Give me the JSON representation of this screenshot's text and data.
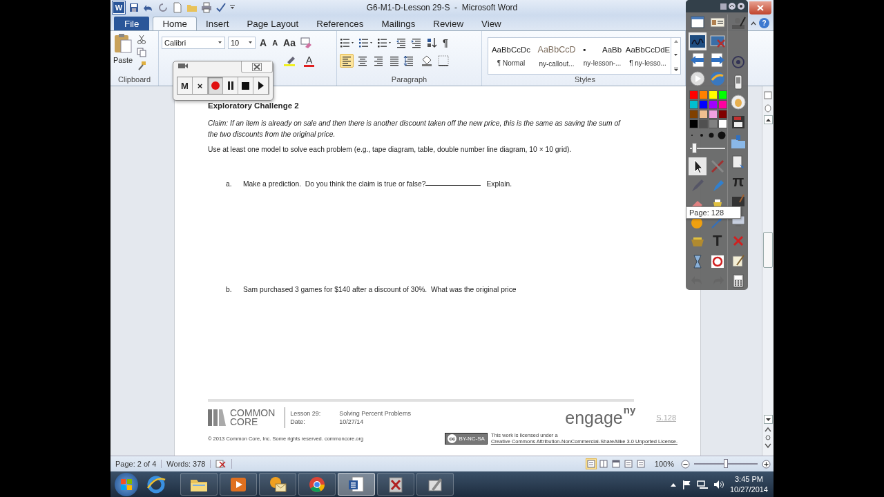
{
  "window": {
    "app_icon": "W",
    "title": "G6-M1-D-Lesson 29-S  -  Microsoft Word",
    "help": "?"
  },
  "tabs": [
    {
      "label": "File",
      "kind": "file",
      "selected": false
    },
    {
      "label": "Home",
      "kind": "tab",
      "selected": true
    },
    {
      "label": "Insert",
      "kind": "tab",
      "selected": false
    },
    {
      "label": "Page Layout",
      "kind": "tab",
      "selected": false
    },
    {
      "label": "References",
      "kind": "tab",
      "selected": false
    },
    {
      "label": "Mailings",
      "kind": "tab",
      "selected": false
    },
    {
      "label": "Review",
      "kind": "tab",
      "selected": false
    },
    {
      "label": "View",
      "kind": "tab",
      "selected": false
    }
  ],
  "ribbon": {
    "clipboard": {
      "paste_label": "Paste",
      "group_label": "Clipboard"
    },
    "font": {
      "family": "Calibri",
      "size": "10",
      "grow": "A",
      "shrink": "A",
      "change_case": "Aa",
      "font_color": "A"
    },
    "paragraph": {
      "pilcrow": "¶",
      "group_label": "Paragraph",
      "alignment": [
        {
          "kind": "left",
          "selected": true
        },
        {
          "kind": "center",
          "selected": false
        },
        {
          "kind": "right",
          "selected": false
        },
        {
          "kind": "justify",
          "selected": false
        }
      ]
    },
    "styles": {
      "group_label": "Styles",
      "items": [
        {
          "preview": "AaBbCcDc",
          "name": "¶ Normal",
          "kind": "plain"
        },
        {
          "preview": "AaBbCcD",
          "name": "ny-callout...",
          "kind": "callout"
        },
        {
          "marker": "▪",
          "preview": "AaBb",
          "name": "ny-lesson-...",
          "kind": "small"
        },
        {
          "preview": "AaBbCcDdE",
          "name": "¶ ny-lesso...",
          "kind": "plain"
        }
      ]
    }
  },
  "recorder": {
    "buttons": [
      {
        "kind": "text",
        "label": "M",
        "selected": false
      },
      {
        "kind": "text",
        "label": "×",
        "selected": false
      },
      {
        "kind": "record",
        "selected": true
      },
      {
        "kind": "pause",
        "selected": false
      },
      {
        "kind": "stop",
        "selected": false
      },
      {
        "kind": "play",
        "selected": false
      }
    ]
  },
  "document": {
    "heading": "Exploratory Challenge 2",
    "claim": "Claim: If an item is already on sale and then there is another discount taken off the new price, this is the same as saving the sum of the two discounts from the original price.",
    "instruction": "Use at least one model to solve each problem (e.g., tape diagram, table, double number line diagram, 10 × 10 grid).",
    "questions": [
      {
        "letter": "a.",
        "text": "Make a prediction.  Do you think the claim is true or false?",
        "blank": true,
        "after": "Explain."
      },
      {
        "letter": "b.",
        "text": "Sam purchased 3 games for $140 after a discount of 30%.  What was the original price",
        "blank": false
      }
    ],
    "footer": {
      "logo": [
        "COMMON",
        "CORE"
      ],
      "fields": [
        {
          "label": "Lesson 29:",
          "value": "Solving Percent Problems"
        },
        {
          "label": "Date:",
          "value": "10/27/14"
        }
      ],
      "brand": "engage",
      "brand_sup": "ny",
      "page_number": "S.128",
      "copyright": "© 2013 Common Core, Inc. Some rights reserved. commoncore.org",
      "badge_icon": "cc",
      "badge": "BY-NC-SA",
      "license_note": "This work is licensed under a",
      "license_link": "Creative Commons Attribution-NonCommercial-ShareAlike 3.0 Unported License."
    }
  },
  "toolbox": {
    "colors": [
      {
        "color": "#ff0000"
      },
      {
        "color": "#ff8000"
      },
      {
        "color": "#ffff00"
      },
      {
        "color": "#00ff00"
      },
      {
        "color": "#00c0d0"
      },
      {
        "color": "#0000ff"
      },
      {
        "color": "#a000ff"
      },
      {
        "color": "#ff00a0"
      },
      {
        "color": "#804000"
      },
      {
        "color": "#f0c090"
      },
      {
        "color": "#f0a0e0"
      },
      {
        "color": "#800000"
      },
      {
        "color": "#000000"
      },
      {
        "color": "#505050"
      },
      {
        "color": "#808080"
      },
      {
        "color": "#ffffff"
      }
    ],
    "pen_width": {
      "level": 0.05
    },
    "pi_tool": "π",
    "text_tool": "T",
    "tooltip": "Page: 128"
  },
  "status_bar": {
    "page": "Page: 2 of 4",
    "words": "Words: 378",
    "views": [
      {
        "kind": "print",
        "selected": true
      },
      {
        "kind": "read",
        "selected": false
      },
      {
        "kind": "web",
        "selected": false
      },
      {
        "kind": "outline",
        "selected": false
      },
      {
        "kind": "draft",
        "selected": false
      }
    ],
    "zoom": "100%",
    "zoom_slider": {
      "level": 0.5
    }
  },
  "taskbar": {
    "apps": [
      {
        "kind": "folder",
        "selected": false
      },
      {
        "kind": "media",
        "selected": false
      },
      {
        "kind": "mail",
        "selected": false
      },
      {
        "kind": "browser",
        "selected": false
      },
      {
        "kind": "word",
        "selected": true
      },
      {
        "kind": "pdf",
        "selected": false
      },
      {
        "kind": "pen",
        "selected": false
      }
    ],
    "time": "3:45 PM",
    "date": "10/27/2014"
  }
}
